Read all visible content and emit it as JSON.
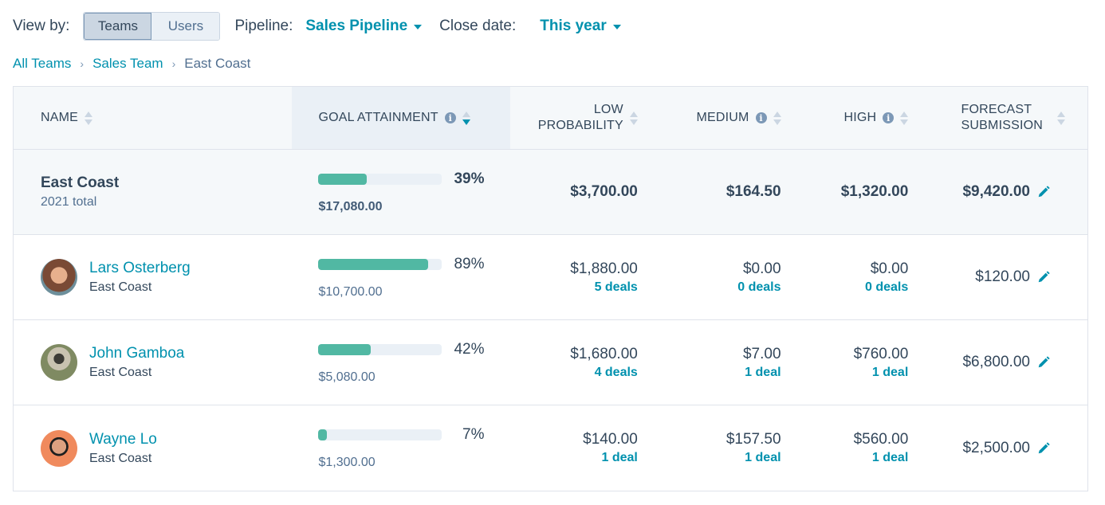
{
  "filters": {
    "view_by_label": "View by:",
    "view_options": [
      "Teams",
      "Users"
    ],
    "active_view": "Teams",
    "pipeline_label": "Pipeline:",
    "pipeline_value": "Sales Pipeline",
    "close_date_label": "Close date:",
    "close_date_value": "This year"
  },
  "breadcrumb": {
    "items": [
      "All Teams",
      "Sales Team"
    ],
    "current": "East Coast",
    "separator": "›"
  },
  "table": {
    "columns": {
      "name": "NAME",
      "goal": "GOAL ATTAINMENT",
      "low_line1": "LOW",
      "low_line2": "PROBABILITY",
      "medium": "MEDIUM",
      "high": "HIGH",
      "forecast_line1": "FORECAST",
      "forecast_line2": "SUBMISSION"
    },
    "sorted_column": "goal",
    "sort_direction": "descending",
    "summary": {
      "name": "East Coast",
      "sub": "2021 total",
      "goal_pct_value": 39,
      "goal_pct": "39%",
      "goal_amount": "$17,080.00",
      "low": "$3,700.00",
      "medium": "$164.50",
      "high": "$1,320.00",
      "forecast": "$9,420.00"
    },
    "rows": [
      {
        "name": "Lars Osterberg",
        "team": "East Coast",
        "goal_pct_value": 89,
        "goal_pct": "89%",
        "goal_amount": "$10,700.00",
        "low": "$1,880.00",
        "low_deals": "5 deals",
        "medium": "$0.00",
        "medium_deals": "0 deals",
        "high": "$0.00",
        "high_deals": "0 deals",
        "forecast": "$120.00"
      },
      {
        "name": "John Gamboa",
        "team": "East Coast",
        "goal_pct_value": 42,
        "goal_pct": "42%",
        "goal_amount": "$5,080.00",
        "low": "$1,680.00",
        "low_deals": "4 deals",
        "medium": "$7.00",
        "medium_deals": "1 deal",
        "high": "$760.00",
        "high_deals": "1 deal",
        "forecast": "$6,800.00"
      },
      {
        "name": "Wayne Lo",
        "team": "East Coast",
        "goal_pct_value": 7,
        "goal_pct": "7%",
        "goal_amount": "$1,300.00",
        "low": "$140.00",
        "low_deals": "1 deal",
        "medium": "$157.50",
        "medium_deals": "1 deal",
        "high": "$560.00",
        "high_deals": "1 deal",
        "forecast": "$2,500.00"
      }
    ]
  },
  "colors": {
    "accent": "#0091ae",
    "progress": "#51b8a3",
    "text": "#33475b",
    "muted": "#516f90"
  }
}
